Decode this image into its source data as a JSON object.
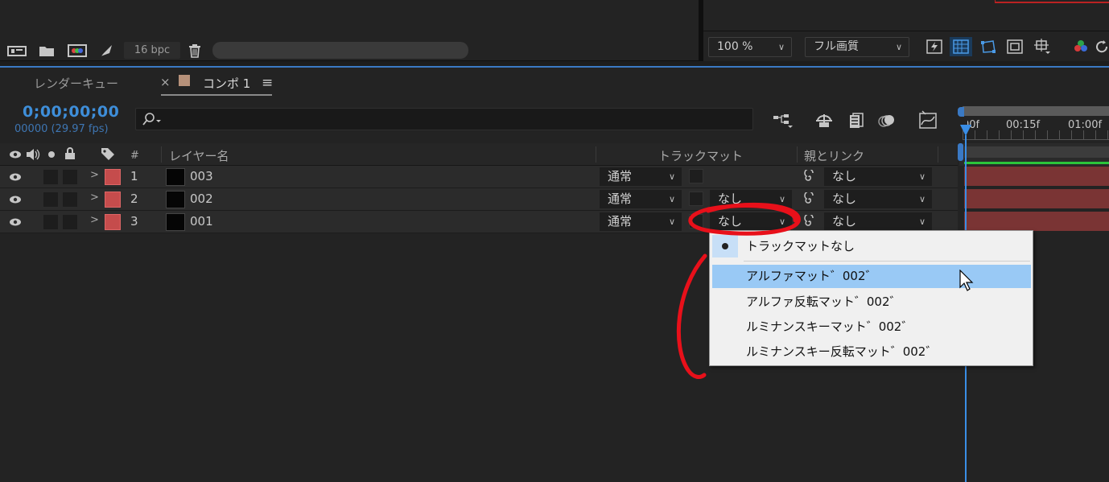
{
  "project_footer": {
    "bpc_label": "16 bpc"
  },
  "viewer_toolbar": {
    "zoom_value": "100 %",
    "quality_value": "フル画質"
  },
  "tabs": {
    "render_queue": "レンダーキュー",
    "comp_close": "×",
    "comp": "コンポ 1",
    "menu_icon": "≡"
  },
  "comp": {
    "timecode": "0;00;00;00",
    "frame_info": "00000 (29.97 fps)"
  },
  "columns": {
    "number": "#",
    "layer_name": "レイヤー名",
    "track_matte": "トラックマット",
    "parent": "親とリンク"
  },
  "timeline": {
    "ticks": [
      "00f",
      "00:15f",
      "01:00f"
    ]
  },
  "layers": [
    {
      "index": "1",
      "name": "003",
      "mode": "通常",
      "matte": "",
      "parent": "なし"
    },
    {
      "index": "2",
      "name": "002",
      "mode": "通常",
      "matte": "なし",
      "parent": "なし"
    },
    {
      "index": "3",
      "name": "001",
      "mode": "通常",
      "matte": "なし",
      "parent": "なし"
    }
  ],
  "track_matte_menu": {
    "items": [
      "トラックマットなし",
      "アルファマット゛002゛",
      "アルファ反転マット゛002゛",
      "ルミナンスキーマット゛002゛",
      "ルミナンスキー反転マット゛002゛"
    ],
    "selected": "トラックマットなし",
    "highlighted": "アルファマット゛002゛"
  },
  "colors": {
    "accent_blue": "#3e8ed9",
    "label_red": "#c54c4c",
    "annotation_red": "#e8101a",
    "menu_highlight": "#99c9f5"
  }
}
